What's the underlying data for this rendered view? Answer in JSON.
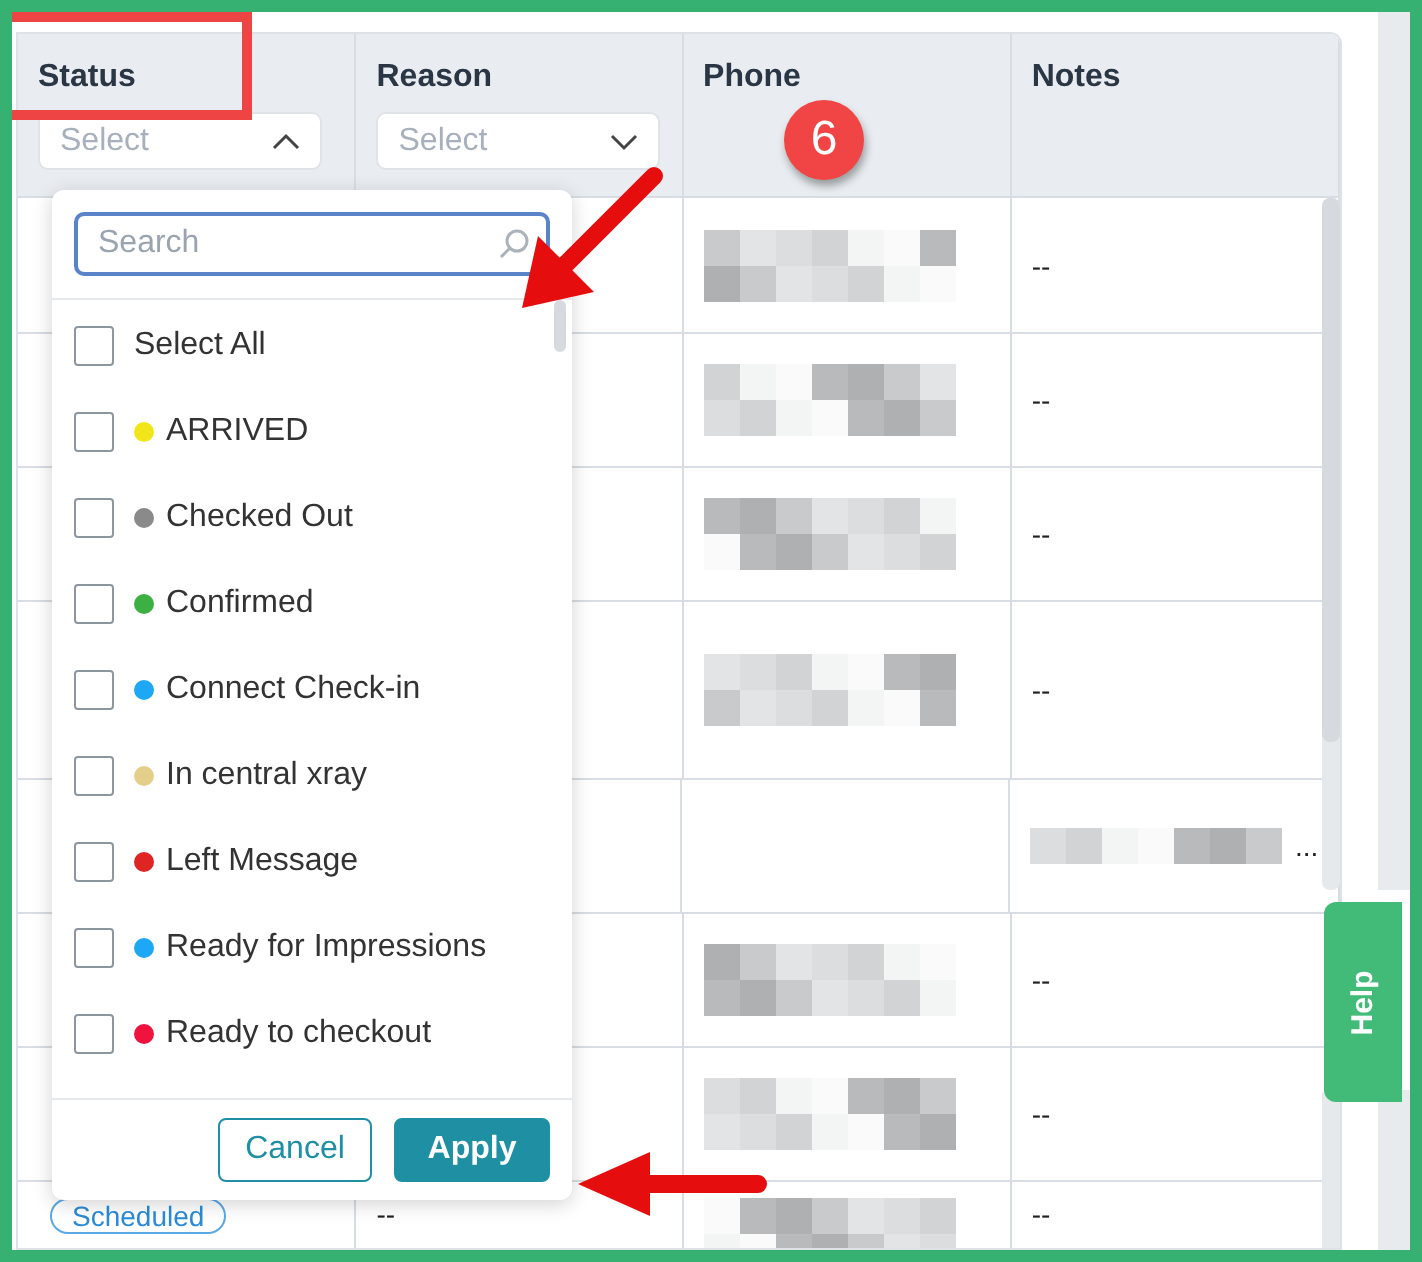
{
  "table": {
    "columns": [
      {
        "label": "Status",
        "filter": {
          "placeholder": "Select",
          "expanded": true
        }
      },
      {
        "label": "Reason",
        "filter": {
          "placeholder": "Select",
          "expanded": false
        }
      },
      {
        "label": "Phone"
      },
      {
        "label": "Notes"
      }
    ],
    "rows": [
      {
        "phone_redacted": true,
        "notes": "--"
      },
      {
        "phone_redacted": true,
        "notes": "--"
      },
      {
        "phone_redacted": true,
        "notes": "--"
      },
      {
        "phone_redacted": true,
        "notes": "--"
      },
      {
        "phone_redacted": false,
        "notes": "...",
        "notes_redacted": true
      },
      {
        "phone_redacted": true,
        "notes": "--"
      },
      {
        "phone_redacted": true,
        "notes": "--"
      },
      {
        "status": "Scheduled",
        "reason": "--",
        "phone_redacted": true,
        "notes": "--"
      }
    ]
  },
  "status_dropdown": {
    "search": {
      "placeholder": "Search"
    },
    "options": [
      {
        "label": "Select All",
        "checked": false
      },
      {
        "label": "ARRIVED",
        "checked": false,
        "color": "#f2e51a"
      },
      {
        "label": "Checked Out",
        "checked": false,
        "color": "#8a8a8a"
      },
      {
        "label": "Confirmed",
        "checked": false,
        "color": "#3cb043"
      },
      {
        "label": "Connect Check-in",
        "checked": false,
        "color": "#1ea7f5"
      },
      {
        "label": "In central xray",
        "checked": false,
        "color": "#e3cf8a"
      },
      {
        "label": "Left Message",
        "checked": false,
        "color": "#e02424"
      },
      {
        "label": "Ready for Impressions",
        "checked": false,
        "color": "#1ea7f5"
      },
      {
        "label": "Ready to checkout",
        "checked": false,
        "color": "#f0123f"
      }
    ],
    "buttons": [
      {
        "label": "Cancel",
        "kind": "secondary"
      },
      {
        "label": "Apply",
        "kind": "primary"
      }
    ]
  },
  "help_tab": {
    "label": "Help"
  },
  "annotations": {
    "step_badge": "6"
  }
}
